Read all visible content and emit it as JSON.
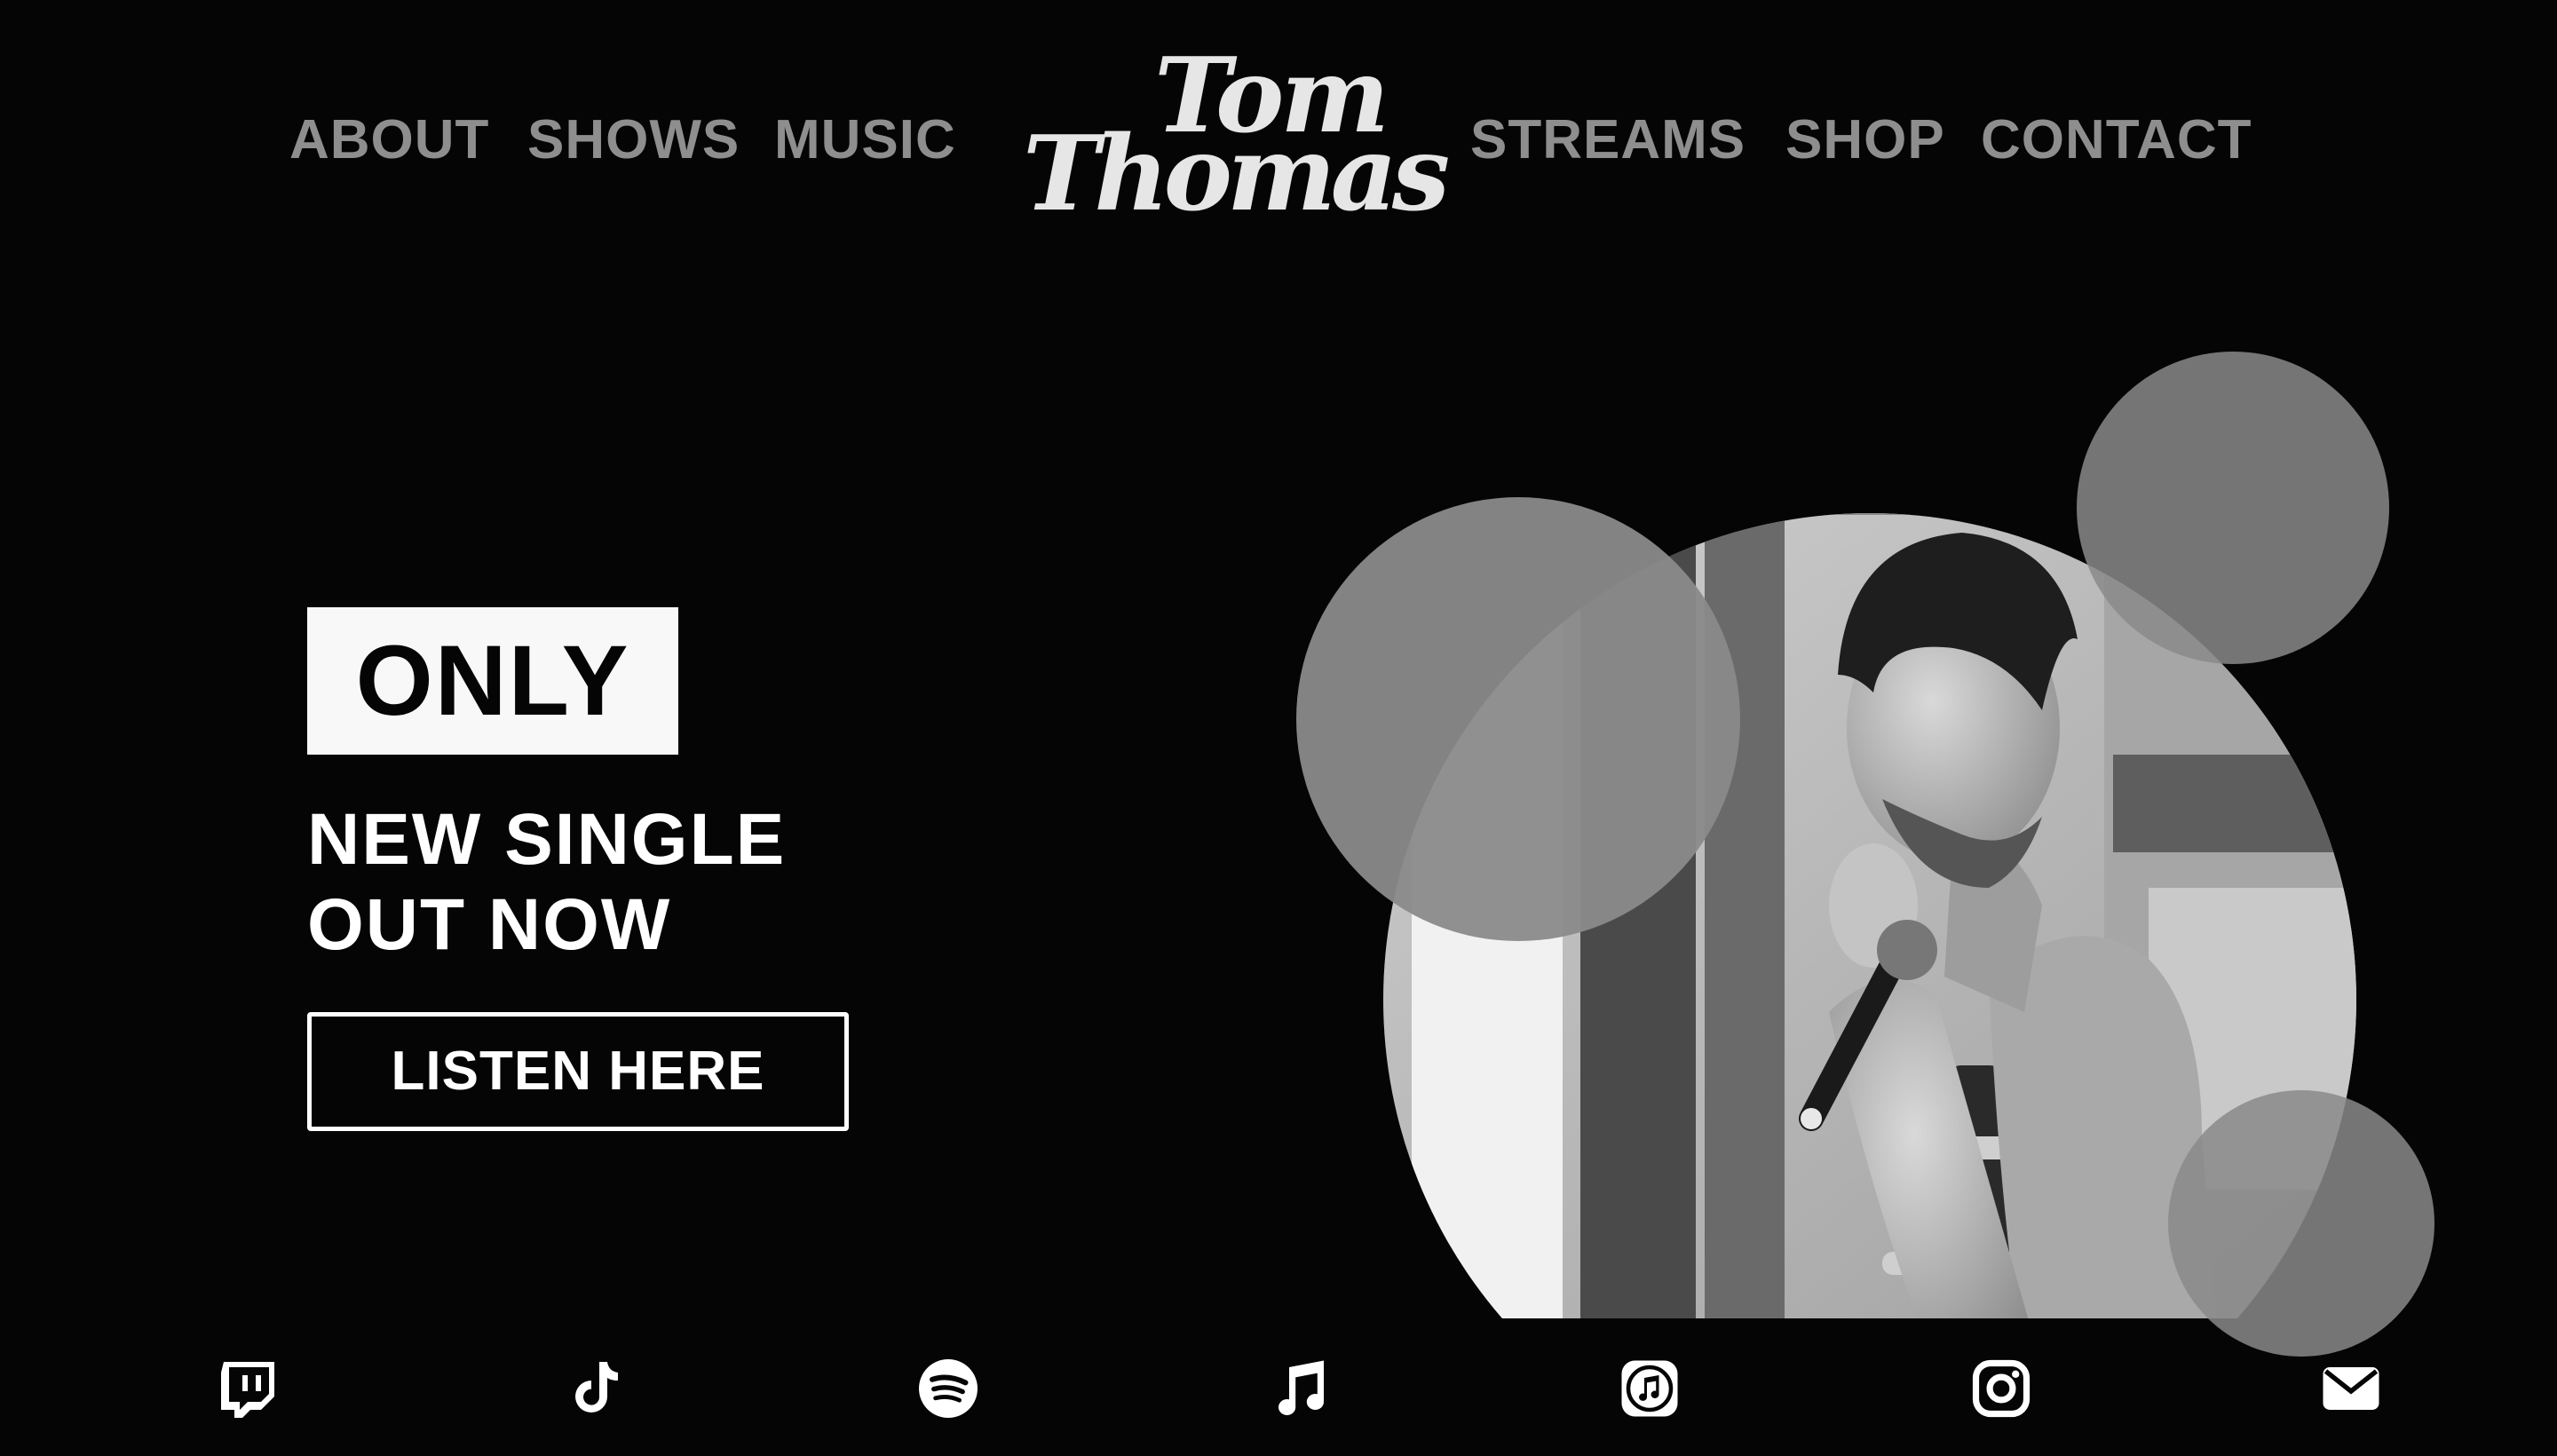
{
  "brand": {
    "logo_line_1": "Tom",
    "logo_line_2": "Thomas"
  },
  "nav": {
    "left": [
      {
        "label": "ABOUT"
      },
      {
        "label": "SHOWS"
      },
      {
        "label": "MUSIC"
      }
    ],
    "right": [
      {
        "label": "STREAMS"
      },
      {
        "label": "SHOP"
      },
      {
        "label": "CONTACT"
      }
    ]
  },
  "hero": {
    "badge": "ONLY",
    "headline_line_1": "NEW SINGLE",
    "headline_line_2": "OUT NOW",
    "cta_label": "LISTEN HERE",
    "image_description": "black-and-white photo of singer with microphone inside a circle"
  },
  "social": [
    {
      "name": "twitch",
      "icon": "twitch-icon"
    },
    {
      "name": "tiktok",
      "icon": "tiktok-icon"
    },
    {
      "name": "spotify",
      "icon": "spotify-icon"
    },
    {
      "name": "music",
      "icon": "music-note-icon"
    },
    {
      "name": "itunes",
      "icon": "itunes-icon"
    },
    {
      "name": "instagram",
      "icon": "instagram-icon"
    },
    {
      "name": "email",
      "icon": "mail-icon"
    }
  ],
  "colors": {
    "background": "#050505",
    "nav_text": "#8e8e8e",
    "accent_white": "#ffffff",
    "bubble_gray": "#8a8a8a"
  }
}
